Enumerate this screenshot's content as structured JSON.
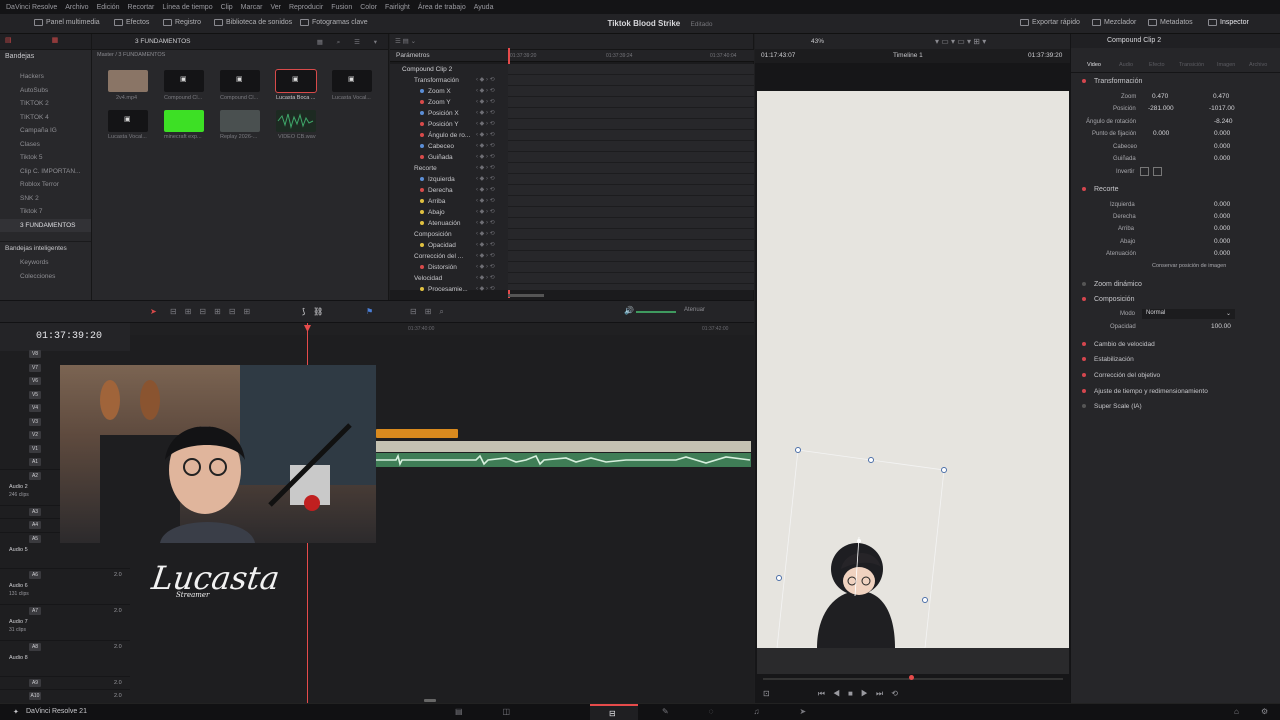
{
  "menu": [
    "DaVinci Resolve",
    "Archivo",
    "Edición",
    "Recortar",
    "Línea de tiempo",
    "Clip",
    "Marcar",
    "Ver",
    "Reproducir",
    "Fusion",
    "Color",
    "Fairlight",
    "Área de trabajo",
    "Ayuda"
  ],
  "toolbar": {
    "media_pool": "Panel multimedia",
    "effects": "Efectos",
    "index": "Registro",
    "sound_library": "Biblioteca de sonidos",
    "keyframes": "Fotogramas clave",
    "project_title": "Tiktok Blood Strike",
    "project_status": "Editado",
    "quick_export": "Exportar rápido",
    "mixer": "Mezclador",
    "metadata": "Metadatos",
    "inspector": "Inspector"
  },
  "media_pool": {
    "bins_header": "Bandejas",
    "breadcrumb": "Master / 3 FUNDAMENTOS",
    "current_bin": "3 FUNDAMENTOS",
    "bins": [
      "Hackers",
      "AutoSubs",
      "TIKTOK 2",
      "TIKTOK 4",
      "Campaña IG",
      "Clases",
      "Tiktok 5",
      "Clip C. IMPORTAN...",
      "Roblox Terror",
      "SNK 2",
      "Tiktok 7",
      "3 FUNDAMENTOS"
    ],
    "smart_bins_header": "Bandejas inteligentes",
    "smart_bins": [
      "Keywords",
      "Colecciones"
    ],
    "clips": [
      {
        "name": "2v4.mp4"
      },
      {
        "name": "Compound Cl..."
      },
      {
        "name": "Compound Cl..."
      },
      {
        "name": "Lucasta Boca ..."
      },
      {
        "name": "Lucasta Vocal..."
      },
      {
        "name": "Lucasta Vocal..."
      },
      {
        "name": "minecraft exp..."
      },
      {
        "name": "Replay 2026-..."
      },
      {
        "name": "VIDEO CB.wav"
      }
    ]
  },
  "keyframes": {
    "header": "Parámetros",
    "clip": "Compound Clip 2",
    "timecodes": [
      "01:37:39:20",
      "01:37:39:24",
      "01:37:40:04"
    ],
    "params": [
      {
        "label": "Transformación",
        "group": true
      },
      {
        "label": "Zoom X",
        "color": "#5b8ed6"
      },
      {
        "label": "Zoom Y",
        "color": "#d84a4a"
      },
      {
        "label": "Posición X",
        "color": "#5b8ed6"
      },
      {
        "label": "Posición Y",
        "color": "#d84a4a"
      },
      {
        "label": "Ángulo de ro...",
        "color": "#d84a4a"
      },
      {
        "label": "Cabeceo",
        "color": "#5b8ed6"
      },
      {
        "label": "Guiñada",
        "color": "#d84a4a"
      },
      {
        "label": "Recorte",
        "group": true
      },
      {
        "label": "Izquierda",
        "color": "#5b8ed6"
      },
      {
        "label": "Derecha",
        "color": "#d84a4a"
      },
      {
        "label": "Arriba",
        "color": "#e0c040"
      },
      {
        "label": "Abajo",
        "color": "#e0c040"
      },
      {
        "label": "Atenuación",
        "color": "#e0c040"
      },
      {
        "label": "Composición",
        "group": true
      },
      {
        "label": "Opacidad",
        "color": "#e0c040"
      },
      {
        "label": "Corrección del ...",
        "group": true
      },
      {
        "label": "Distorsión",
        "color": "#d84a4a"
      },
      {
        "label": "Velocidad",
        "group": true
      },
      {
        "label": "Procesamie...",
        "color": "#e0c040"
      }
    ]
  },
  "viewer": {
    "zoom": "43%",
    "timecode_left": "01:17:43:07",
    "timeline_name": "Timeline 1",
    "timecode_right": "01:37:39:20"
  },
  "timeline": {
    "timecode": "01:37:39:20",
    "ruler": [
      "01:37:40:00",
      "01:37:42:00"
    ],
    "attenuate": "Atenuar",
    "video_tracks": [
      "V8",
      "V7",
      "V6",
      "V5",
      "V4",
      "V3",
      "V2",
      "V1"
    ],
    "audio_tracks": [
      {
        "id": "A1"
      },
      {
        "id": "A2",
        "name": "Audio 2",
        "clips": "246 clips"
      },
      {
        "id": "A3"
      },
      {
        "id": "A4"
      },
      {
        "id": "A5",
        "name": "Audio 5"
      },
      {
        "id": "A6",
        "name": "Audio 6",
        "clips": "131 clips"
      },
      {
        "id": "A7",
        "name": "Audio 7",
        "clips": "31 clips"
      },
      {
        "id": "A8",
        "name": "Audio 8"
      },
      {
        "id": "A9"
      },
      {
        "id": "A10"
      }
    ],
    "track_level": "2.0",
    "overlay_signature": "Lucasta",
    "overlay_sub": "Streamer"
  },
  "inspector": {
    "clip_title": "Compound Clip 2",
    "tabs": [
      "Video",
      "Audio",
      "Efecto",
      "Transición",
      "Imagen",
      "Archivo"
    ],
    "transform": {
      "label": "Transformación",
      "zoom_label": "Zoom",
      "zoom_x": "0.470",
      "zoom_y": "0.470",
      "position_label": "Posición",
      "pos_x": "-281.000",
      "pos_y": "-1017.00",
      "rotation_label": "Ángulo de rotación",
      "rotation": "-8.240",
      "anchor_label": "Punto de fijación",
      "anchor_x": "0.000",
      "anchor_y": "0.000",
      "pitch_label": "Cabeceo",
      "pitch": "0.000",
      "yaw_label": "Guiñada",
      "yaw": "0.000",
      "flip_label": "Invertir"
    },
    "crop": {
      "label": "Recorte",
      "left_label": "Izquierda",
      "left": "0.000",
      "right_label": "Derecha",
      "right": "0.000",
      "top_label": "Arriba",
      "top": "0.000",
      "bottom_label": "Abajo",
      "bottom": "0.000",
      "soft_label": "Atenuación",
      "soft": "0.000",
      "retain_label": "Conservar posición de imagen"
    },
    "dynamic_zoom": "Zoom dinámico",
    "composite": {
      "label": "Composición",
      "mode_label": "Modo",
      "mode": "Normal",
      "opacity_label": "Opacidad",
      "opacity": "100.00"
    },
    "sections": [
      "Cambio de velocidad",
      "Estabilización",
      "Corrección del objetivo",
      "Ajuste de tiempo y redimensionamiento",
      "Super Scale (IA)"
    ]
  },
  "taskbar": {
    "app": "DaVinci Resolve 21"
  },
  "colors": {
    "accent_red": "#e64b4b",
    "playhead": "#e64b4b",
    "clip_orange": "#d98a1e",
    "audio_green": "#3f7d56",
    "panel": "#28282b"
  }
}
